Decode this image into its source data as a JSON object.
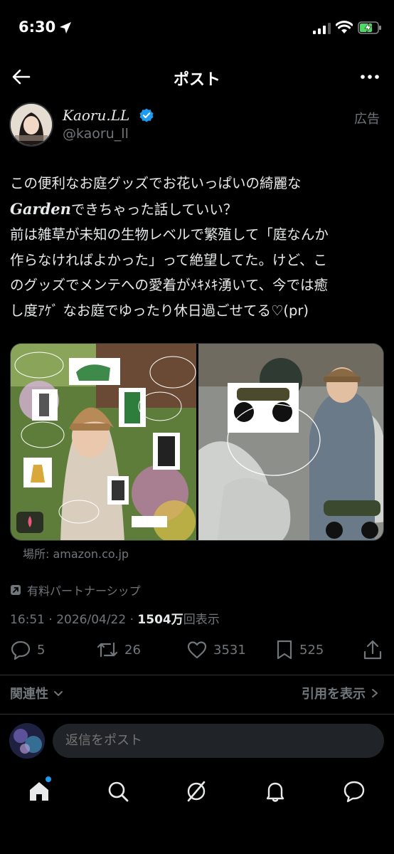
{
  "status_bar": {
    "time": "6:30"
  },
  "header": {
    "title": "ポスト"
  },
  "author": {
    "display_name": "Kaoru.LL",
    "handle": "@kaoru_ll",
    "ad_label": "広告"
  },
  "post": {
    "line1": "この便利なお庭グッズでお花いっぱいの綺麗な",
    "line2_garden": "Garden",
    "line2_rest": "できちゃった話していい？",
    "line3": "前は雑草が未知の生物レベルで繁殖して「庭なんか",
    "line4": "作らなければよかった」って絶望してた。けど、こ",
    "line5": "のグッズでメンテへの愛着がﾒｷﾒｷ湧いて、今では癒",
    "line6": "し度ｱｹﾞ なお庭でゆったり休日過ごせてる♡(pr)"
  },
  "media": {
    "location": "場所: amazon.co.jp"
  },
  "partnership": "有料パートナーシップ",
  "meta": {
    "timestamp": "16:51 · 2026/04/22 · ",
    "views_count": "1504万",
    "views_label": "回表示"
  },
  "actions": {
    "replies": "5",
    "reposts": "26",
    "likes": "3531",
    "bookmarks": "525"
  },
  "related": {
    "label": "関連性",
    "quotes_label": "引用を表示"
  },
  "reply": {
    "placeholder": "返信をポスト"
  },
  "colors": {
    "background": "#000000",
    "text": "#e7e9ea",
    "secondary": "#71767b",
    "accent": "#1d9bf0"
  }
}
